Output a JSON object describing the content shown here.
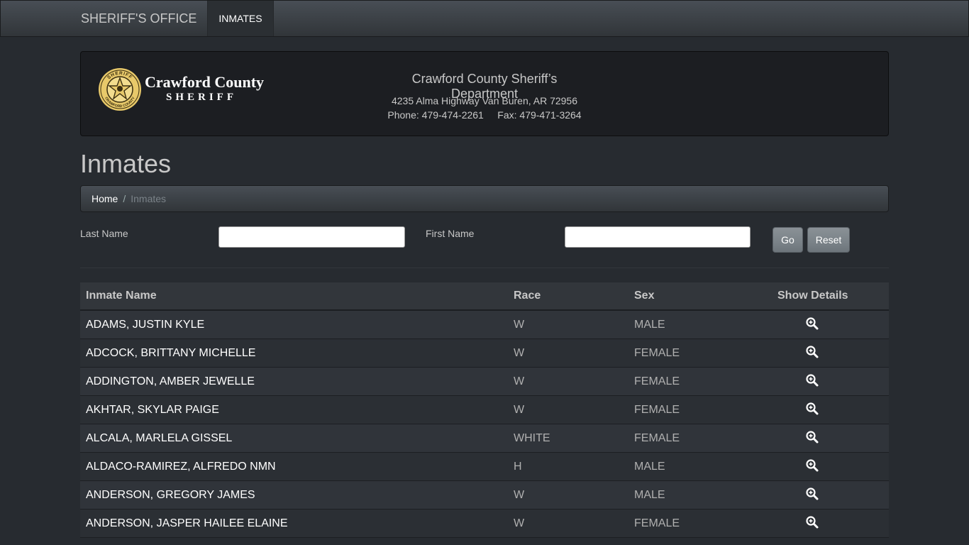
{
  "navbar": {
    "brand": "SHERIFF'S OFFICE",
    "items": [
      {
        "label": "INMATES"
      }
    ]
  },
  "banner": {
    "logo": {
      "line1": "Crawford County",
      "line2": "SHERIFF",
      "seal_top": "SHERIFF",
      "seal_bottom": "CRAWFORD COUNTY"
    },
    "department": "Crawford County Sheriff’s Department",
    "address": "4235 Alma Highway Van Buren, AR 72956",
    "phone": "Phone: 479-474-2261     Fax: 479-471-3264"
  },
  "page_title": "Inmates",
  "breadcrumb": {
    "home": "Home",
    "separator": "/",
    "current": "Inmates"
  },
  "search": {
    "last_name_label": "Last Name",
    "last_name_value": "",
    "first_name_label": "First Name",
    "first_name_value": "",
    "go_label": "Go",
    "reset_label": "Reset"
  },
  "table": {
    "columns": [
      "Inmate Name",
      "Race",
      "Sex",
      "Show Details"
    ],
    "detail_icon": "zoom-in-icon",
    "rows": [
      {
        "name": "ADAMS, JUSTIN KYLE",
        "race": "W",
        "sex": "MALE"
      },
      {
        "name": "ADCOCK, BRITTANY MICHELLE",
        "race": "W",
        "sex": "FEMALE"
      },
      {
        "name": "ADDINGTON, AMBER JEWELLE",
        "race": "W",
        "sex": "FEMALE"
      },
      {
        "name": "AKHTAR, SKYLAR PAIGE",
        "race": "W",
        "sex": "FEMALE"
      },
      {
        "name": "ALCALA, MARLELA GISSEL",
        "race": "WHITE",
        "sex": "FEMALE"
      },
      {
        "name": "ALDACO-RAMIREZ, ALFREDO NMN",
        "race": "H",
        "sex": "MALE"
      },
      {
        "name": "ANDERSON, GREGORY JAMES",
        "race": "W",
        "sex": "MALE"
      },
      {
        "name": "ANDERSON, JASPER HAILEE ELAINE",
        "race": "W",
        "sex": "FEMALE"
      }
    ]
  }
}
